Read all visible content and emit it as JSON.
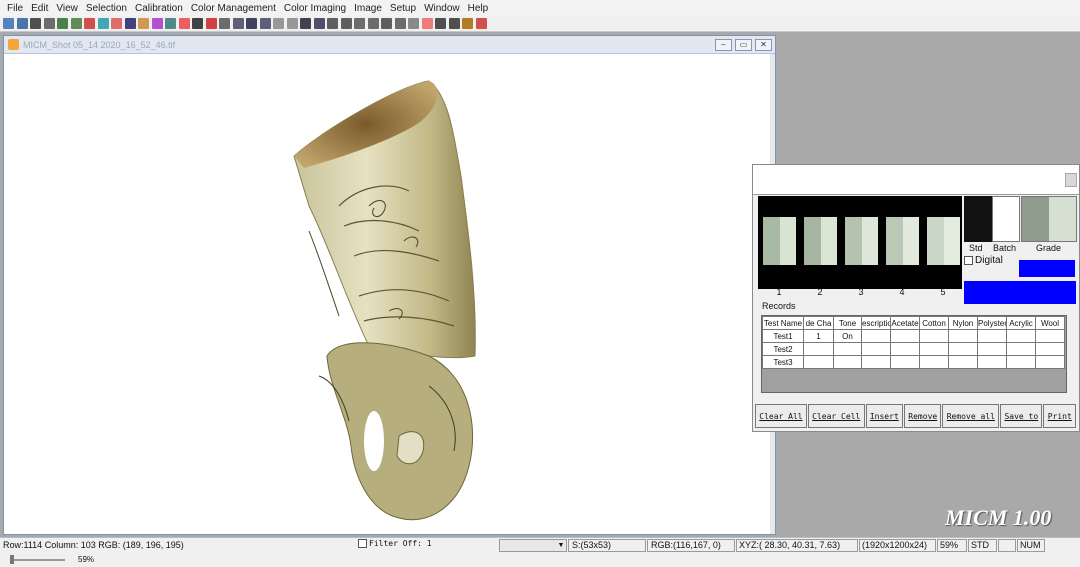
{
  "menubar": {
    "items": [
      "File",
      "Edit",
      "View",
      "Selection",
      "Calibration",
      "Color Management",
      "Color Imaging",
      "Image",
      "Setup",
      "Window",
      "Help"
    ]
  },
  "toolbar": {
    "icons": [
      "open-icon",
      "save-icon",
      "camera-icon",
      "film-icon",
      "image-icon",
      "frame-icon",
      "grid-icon",
      "grid-color-icon",
      "palette-icon",
      "crosshair-icon",
      "chart-icon",
      "colors-icon",
      "cube-icon",
      "swatches-icon",
      "pen-icon",
      "drop-icon",
      "infinity-icon",
      "zoom-in-icon",
      "one-to-one-icon",
      "zoom-out-icon",
      "undo-icon",
      "redo-icon",
      "text-icon",
      "pencil-icon",
      "rectangle-icon",
      "ellipse-icon",
      "list-icon",
      "table-icon",
      "crop-icon",
      "clock-icon",
      "arrow-icon",
      "stop-icon",
      "hand-icon",
      "magnifier-icon",
      "pin-icon",
      "target-icon"
    ]
  },
  "image_window": {
    "title": "MICM_Shot 05_14 2020_16_52_46.tif",
    "minimize": "‒",
    "restore": "▭",
    "close": "✕"
  },
  "panel": {
    "swatch_numbers": [
      "1",
      "2",
      "3",
      "4",
      "5"
    ],
    "swatch_colors": [
      [
        "#a8b9a4",
        "#d8e3d2"
      ],
      [
        "#a6b6a1",
        "#dbe5d6"
      ],
      [
        "#b3c3af",
        "#dde7d9"
      ],
      [
        "#b9c9b5",
        "#e0e9dc"
      ],
      [
        "#cbd8c7",
        "#e4ecdf"
      ]
    ],
    "std_label": "Std",
    "batch_label": "Batch",
    "grade_label": "Grade",
    "grade_colors": [
      "#8f9c8c",
      "#d5e0d0"
    ],
    "digital_label": "Digital",
    "records_label": "Records",
    "table": {
      "headers": [
        "Test Name",
        "de Cha",
        "Tone",
        "escriptio",
        "Acetate",
        "Cotton",
        "Nylon",
        "Polyster",
        "Acrylic",
        "Wool"
      ],
      "rows": [
        [
          "Test1",
          "1",
          "On",
          "",
          "",
          "",
          "",
          "",
          "",
          ""
        ],
        [
          "Test2",
          "",
          "",
          "",
          "",
          "",
          "",
          "",
          "",
          ""
        ],
        [
          "Test3",
          "",
          "",
          "",
          "",
          "",
          "",
          "",
          "",
          ""
        ]
      ]
    },
    "buttons": [
      "Clear All",
      "Clear Cell",
      "Insert",
      "Remove",
      "Remove all",
      "Save to",
      "Print"
    ]
  },
  "watermark": "MICM 1.00",
  "statusbar": {
    "position": "Row:1114 Column: 103  RGB: (189, 196, 195)",
    "filter": "Filter Off: 1",
    "sample_size": "S:(53x53)",
    "rgb": "RGB:(116,167,  0)",
    "xyz": "XYZ:( 28.30, 40.31,  7.63)",
    "resolution": "(1920x1200x24)",
    "zoom": "59%",
    "std": "STD",
    "num": "NUM"
  },
  "zoom": {
    "value": "59%",
    "fraction": 0.0
  }
}
